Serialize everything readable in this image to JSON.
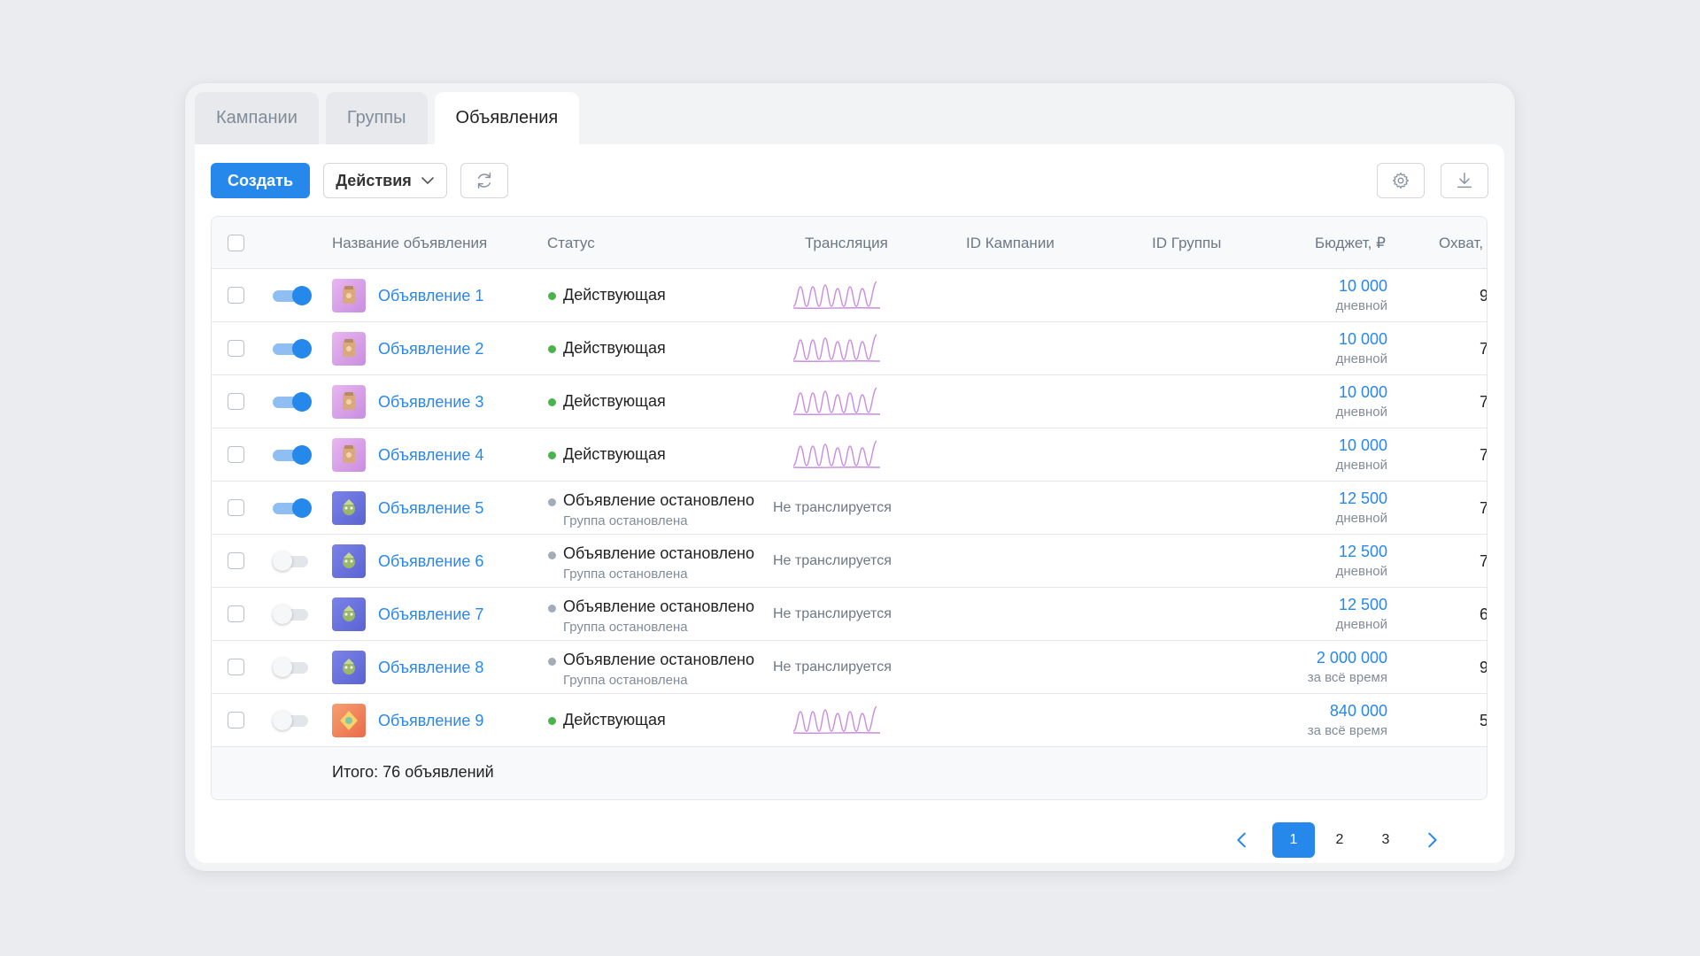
{
  "tabs": [
    {
      "label": "Кампании",
      "active": false
    },
    {
      "label": "Группы",
      "active": false
    },
    {
      "label": "Объявления",
      "active": true
    }
  ],
  "toolbar": {
    "create_label": "Создать",
    "actions_label": "Действия"
  },
  "table": {
    "columns": [
      "Название объявления",
      "Статус",
      "Трансляция",
      "ID Кампании",
      "ID Группы",
      "Бюджет, ₽",
      "Охват,"
    ],
    "rows": [
      {
        "name": "Объявление 1",
        "enabled": true,
        "thumb": "pink",
        "status": "Действующая",
        "status_color": "green",
        "status_sub": "",
        "broadcast": "",
        "budget": "10 000",
        "budget_period": "дневной",
        "reach": "9"
      },
      {
        "name": "Объявление 2",
        "enabled": true,
        "thumb": "pink",
        "status": "Действующая",
        "status_color": "green",
        "status_sub": "",
        "broadcast": "",
        "budget": "10 000",
        "budget_period": "дневной",
        "reach": "7"
      },
      {
        "name": "Объявление 3",
        "enabled": true,
        "thumb": "pink",
        "status": "Действующая",
        "status_color": "green",
        "status_sub": "",
        "broadcast": "",
        "budget": "10 000",
        "budget_period": "дневной",
        "reach": "7"
      },
      {
        "name": "Объявление 4",
        "enabled": true,
        "thumb": "pink",
        "status": "Действующая",
        "status_color": "green",
        "status_sub": "",
        "broadcast": "",
        "budget": "10 000",
        "budget_period": "дневной",
        "reach": "7"
      },
      {
        "name": "Объявление 5",
        "enabled": true,
        "thumb": "blue",
        "status": "Объявление остановлено",
        "status_color": "grey",
        "status_sub": "Группа остановлена",
        "broadcast": "Не транслируется",
        "budget": "12 500",
        "budget_period": "дневной",
        "reach": "7"
      },
      {
        "name": "Объявление 6",
        "enabled": false,
        "thumb": "blue",
        "status": "Объявление остановлено",
        "status_color": "grey",
        "status_sub": "Группа остановлена",
        "broadcast": "Не транслируется",
        "budget": "12 500",
        "budget_period": "дневной",
        "reach": "7"
      },
      {
        "name": "Объявление 7",
        "enabled": false,
        "thumb": "blue",
        "status": "Объявление остановлено",
        "status_color": "grey",
        "status_sub": "Группа остановлена",
        "broadcast": "Не транслируется",
        "budget": "12 500",
        "budget_period": "дневной",
        "reach": "6"
      },
      {
        "name": "Объявление 8",
        "enabled": false,
        "thumb": "blue",
        "status": "Объявление остановлено",
        "status_color": "grey",
        "status_sub": "Группа остановлена",
        "broadcast": "Не транслируется",
        "budget": "2 000 000",
        "budget_period": "за всё время",
        "reach": "9"
      },
      {
        "name": "Объявление 9",
        "enabled": false,
        "thumb": "orange",
        "status": "Действующая",
        "status_color": "green",
        "status_sub": "",
        "broadcast": "",
        "budget": "840 000",
        "budget_period": "за всё время",
        "reach": "5"
      }
    ],
    "total": "Итого: 76 объявлений"
  },
  "pagination": {
    "pages": [
      "1",
      "2",
      "3"
    ],
    "current": "1"
  },
  "colors": {
    "accent": "#2688eb",
    "status_active": "#4bb34b",
    "status_stopped": "#a3adb8",
    "sparkline": "#c98de0"
  },
  "icons": {
    "refresh": "refresh-icon",
    "settings": "gear-icon",
    "download": "download-icon",
    "prev": "chevron-left-icon",
    "next": "chevron-right-icon"
  }
}
